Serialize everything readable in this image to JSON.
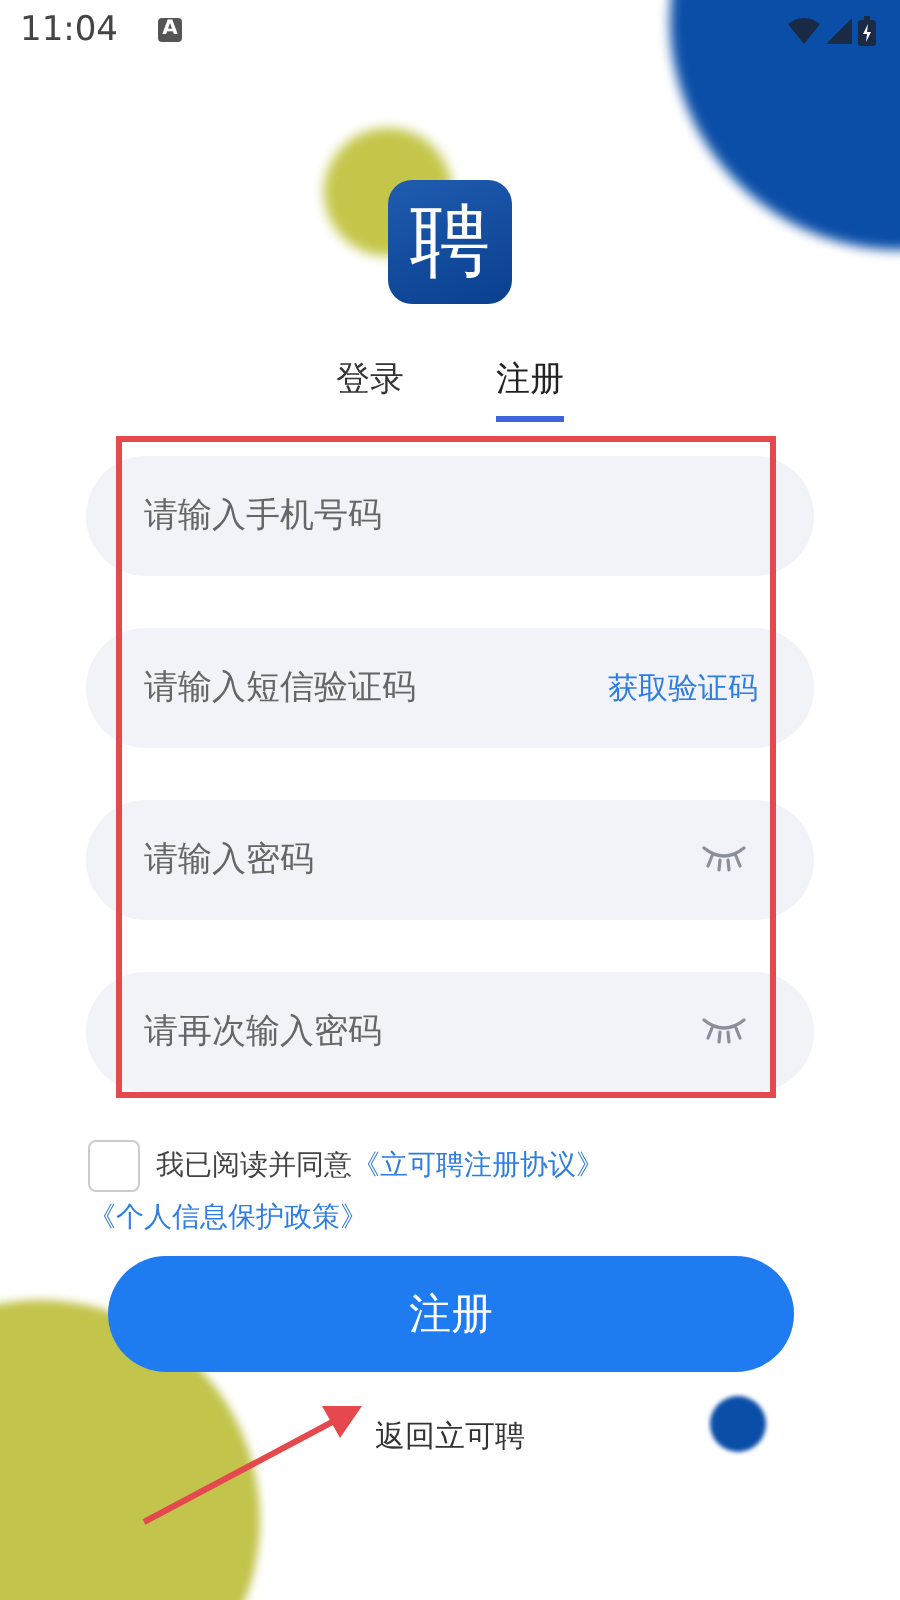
{
  "status_bar": {
    "time": "11:04",
    "notification": "A"
  },
  "logo": {
    "glyph": "聘"
  },
  "tabs": [
    {
      "label": "登录",
      "selected": false
    },
    {
      "label": "注册",
      "selected": true
    }
  ],
  "fields": [
    {
      "kind": "text",
      "placeholder": "请输入手机号码"
    },
    {
      "kind": "code",
      "placeholder": "请输入短信验证码",
      "action": "获取验证码"
    },
    {
      "kind": "password",
      "placeholder": "请输入密码"
    },
    {
      "kind": "password",
      "placeholder": "请再次输入密码"
    }
  ],
  "agreement": {
    "checked": false,
    "text": "我已阅读并同意",
    "links": [
      "《立可聘注册协议》",
      "《个人信息保护政策》"
    ]
  },
  "submit_button": "注册",
  "back_link": "返回立可聘",
  "annotations": {
    "highlight_frame": true,
    "pointer_arrow": true
  }
}
